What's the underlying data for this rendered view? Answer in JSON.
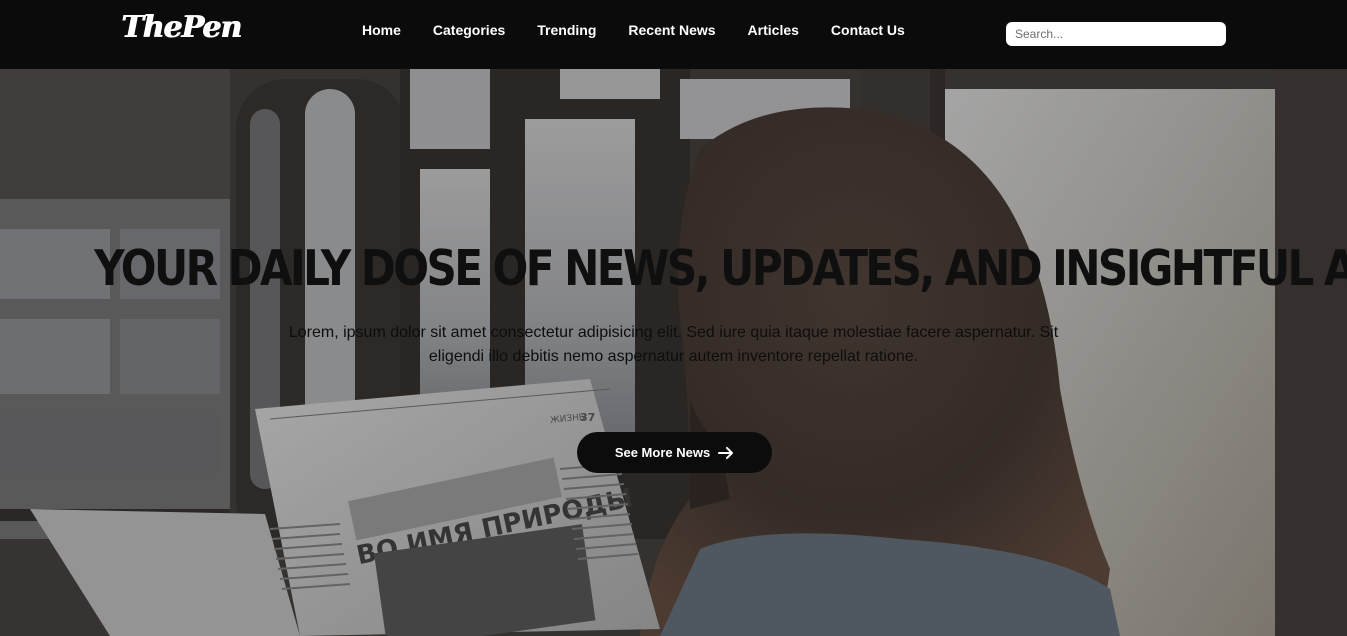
{
  "brand": {
    "logo_text": "ThePen"
  },
  "nav": {
    "links": [
      {
        "label": "Home"
      },
      {
        "label": "Categories"
      },
      {
        "label": "Trending"
      },
      {
        "label": "Recent News"
      },
      {
        "label": "Articles"
      },
      {
        "label": "Contact Us"
      }
    ]
  },
  "search": {
    "placeholder": "Search...",
    "value": ""
  },
  "hero": {
    "headline": "YOUR DAILY DOSE OF NEWS, UPDATES, AND INSIGHTFUL ARTICLES",
    "description_line1": "Lorem, ipsum dolor sit amet consectetur adipisicing elit. Sed iure quia itaque molestiae facere aspernatur. Sit",
    "description_line2": "eligendi illo debitis nemo aspernatur autem inventore repellat ratione.",
    "cta_label": "See More News",
    "cta_icon": "arrow-right-icon",
    "newspaper_headline": "ВО ИМЯ ПРИРОДЫ",
    "newspaper_page": "37"
  },
  "colors": {
    "nav_bg": "#0b0b0b",
    "nav_text": "#ffffff",
    "headline": "#0f0f0f",
    "cta_bg": "#0c0c0c",
    "cta_text": "#ffffff"
  }
}
